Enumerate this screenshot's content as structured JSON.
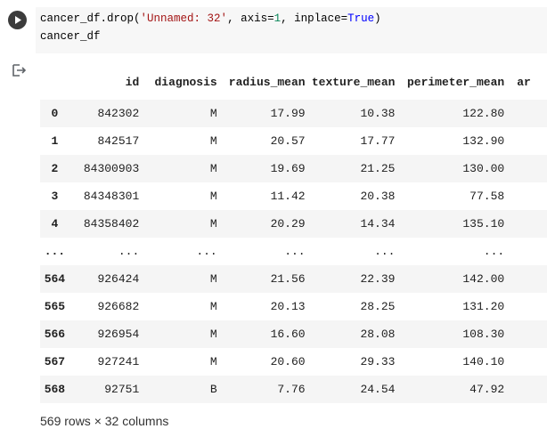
{
  "code": {
    "line1": {
      "a": "cancer_df.drop(",
      "str": "'Unnamed: 32'",
      "b": ", axis=",
      "num": "1",
      "c": ", inplace=",
      "kw": "True",
      "d": ")"
    },
    "line2": "cancer_df"
  },
  "output": {
    "columns": [
      "",
      "id",
      "diagnosis",
      "radius_mean",
      "texture_mean",
      "perimeter_mean",
      "ar"
    ],
    "rows": [
      [
        "0",
        "842302",
        "M",
        "17.99",
        "10.38",
        "122.80",
        ""
      ],
      [
        "1",
        "842517",
        "M",
        "20.57",
        "17.77",
        "132.90",
        ""
      ],
      [
        "2",
        "84300903",
        "M",
        "19.69",
        "21.25",
        "130.00",
        ""
      ],
      [
        "3",
        "84348301",
        "M",
        "11.42",
        "20.38",
        "77.58",
        ""
      ],
      [
        "4",
        "84358402",
        "M",
        "20.29",
        "14.34",
        "135.10",
        ""
      ],
      [
        "...",
        "...",
        "...",
        "...",
        "...",
        "...",
        ""
      ],
      [
        "564",
        "926424",
        "M",
        "21.56",
        "22.39",
        "142.00",
        ""
      ],
      [
        "565",
        "926682",
        "M",
        "20.13",
        "28.25",
        "131.20",
        ""
      ],
      [
        "566",
        "926954",
        "M",
        "16.60",
        "28.08",
        "108.30",
        ""
      ],
      [
        "567",
        "927241",
        "M",
        "20.60",
        "29.33",
        "140.10",
        ""
      ],
      [
        "568",
        "92751",
        "B",
        "7.76",
        "24.54",
        "47.92",
        ""
      ]
    ],
    "footer": "569 rows × 32 columns"
  },
  "icons": {
    "run": "play-icon",
    "output": "output-redirect-icon"
  }
}
